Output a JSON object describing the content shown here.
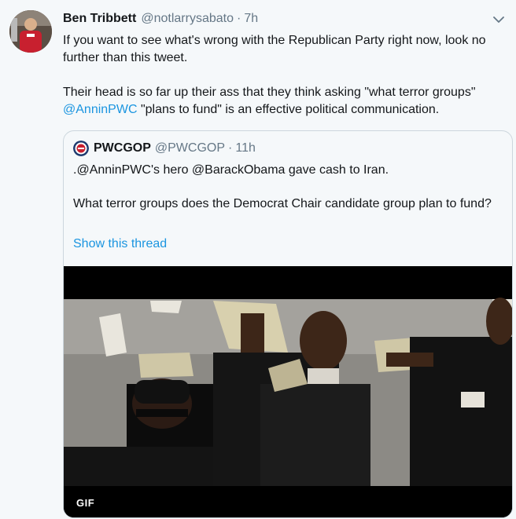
{
  "tweet": {
    "author_name": "Ben Tribbett",
    "author_handle": "@notlarrysabato",
    "separator": "·",
    "time": "7h",
    "paragraph_1": "If you want to see what's wrong with the Republican Party right now, look no further than this tweet.",
    "paragraph_2_text": "Their head is so far up their ass that they think asking \"what terror groups\"",
    "paragraph_2_mention": "@AnninPWC",
    "paragraph_2_tail": " \"plans to fund\" is an effective political communication."
  },
  "quote": {
    "author_name": "PWCGOP",
    "author_handle": "@PWCGOP",
    "separator": "·",
    "time": "11h",
    "paragraph_1": ".@AnninPWC's hero @BarackObama gave cash to Iran.",
    "paragraph_2": "What terror groups does the Democrat Chair candidate group plan to fund?",
    "show_thread": "Show this thread",
    "media_badge": "GIF"
  },
  "icons": {
    "caret": "chevron-down-icon",
    "author_avatar": "avatar",
    "quote_avatar": "pwcgop-logo"
  },
  "colors": {
    "link": "#1b95e0",
    "secondary_text": "#657786",
    "background": "#f5f8fa",
    "border": "#ccd6dd"
  }
}
